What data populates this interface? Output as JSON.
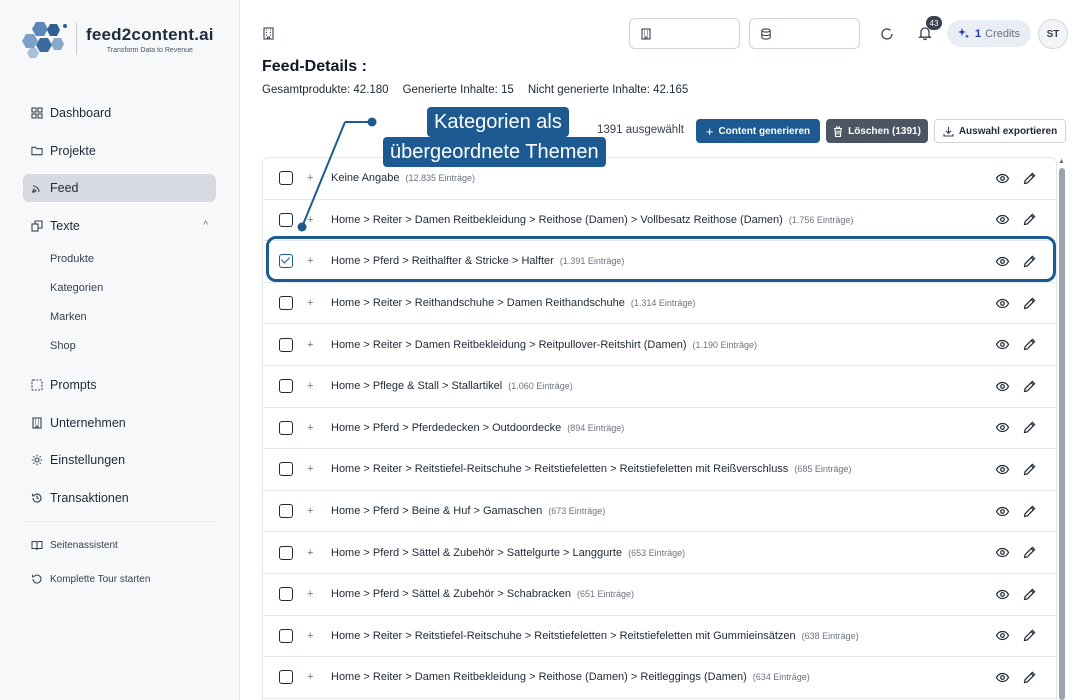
{
  "brand": {
    "name": "feed2content.ai",
    "tagline": "Transform Data to Revenue"
  },
  "sidebar": {
    "items": [
      {
        "label": "Dashboard",
        "icon": "grid-icon"
      },
      {
        "label": "Projekte",
        "icon": "folder-icon"
      },
      {
        "label": "Feed",
        "icon": "rss-icon",
        "active": true
      },
      {
        "label": "Texte",
        "icon": "documents-icon",
        "expanded": true
      }
    ],
    "sub_items": [
      "Produkte",
      "Kategorien",
      "Marken",
      "Shop"
    ],
    "items2": [
      {
        "label": "Prompts",
        "icon": "bracket-icon"
      },
      {
        "label": "Unternehmen",
        "icon": "building-icon"
      },
      {
        "label": "Einstellungen",
        "icon": "gear-icon"
      },
      {
        "label": "Transaktionen",
        "icon": "history-icon"
      }
    ],
    "footer": [
      {
        "label": "Seitenassistent",
        "icon": "book-icon"
      },
      {
        "label": "Komplette Tour starten",
        "icon": "tour-icon"
      }
    ]
  },
  "topbar": {
    "notifications": "43",
    "credits_count": "1",
    "credits_label": "Credits",
    "avatar": "ST"
  },
  "page": {
    "title": "Feed-Details :",
    "stats": [
      "Gesamtprodukte: 42.180",
      "Generierte Inhalte: 15",
      "Nicht generierte Inhalte: 42.165"
    ],
    "selected": "1391 ausgewählt",
    "btn_generate": "Content generieren",
    "btn_delete": "Löschen (1391)",
    "btn_export": "Auswahl exportieren"
  },
  "annotation": {
    "line1": "Kategorien als",
    "line2": "übergeordnete Themen"
  },
  "rows": [
    {
      "path": "Keine Angabe",
      "count": "(12.835 Einträge)",
      "checked": false
    },
    {
      "path": "Home > Reiter > Damen Reitbekleidung > Reithose (Damen) > Vollbesatz Reithose (Damen)",
      "count": "(1.756 Einträge)",
      "checked": false
    },
    {
      "path": "Home > Pferd > Reithalfter & Stricke > Halfter",
      "count": "(1.391 Einträge)",
      "checked": true
    },
    {
      "path": "Home > Reiter > Reithandschuhe > Damen Reithandschuhe",
      "count": "(1.314 Einträge)",
      "checked": false
    },
    {
      "path": "Home > Reiter > Damen Reitbekleidung > Reitpullover-Reitshirt (Damen)",
      "count": "(1.190 Einträge)",
      "checked": false
    },
    {
      "path": "Home > Pflege & Stall > Stallartikel",
      "count": "(1.060 Einträge)",
      "checked": false
    },
    {
      "path": "Home > Pferd > Pferdedecken > Outdoordecke",
      "count": "(894 Einträge)",
      "checked": false
    },
    {
      "path": "Home > Reiter > Reitstiefel-Reitschuhe > Reitstiefeletten > Reitstiefeletten mit Reißverschluss",
      "count": "(685 Einträge)",
      "checked": false
    },
    {
      "path": "Home > Pferd > Beine & Huf > Gamaschen",
      "count": "(673 Einträge)",
      "checked": false
    },
    {
      "path": "Home > Pferd > Sättel & Zubehör > Sattelgurte > Langgurte",
      "count": "(653 Einträge)",
      "checked": false
    },
    {
      "path": "Home > Pferd > Sättel & Zubehör > Schabracken",
      "count": "(651 Einträge)",
      "checked": false
    },
    {
      "path": "Home > Reiter > Reitstiefel-Reitschuhe > Reitstiefeletten > Reitstiefeletten mit Gummieinsätzen",
      "count": "(638 Einträge)",
      "checked": false
    },
    {
      "path": "Home > Reiter > Damen Reitbekleidung > Reithose (Damen) > Reitleggings (Damen)",
      "count": "(634 Einträge)",
      "checked": false
    }
  ]
}
